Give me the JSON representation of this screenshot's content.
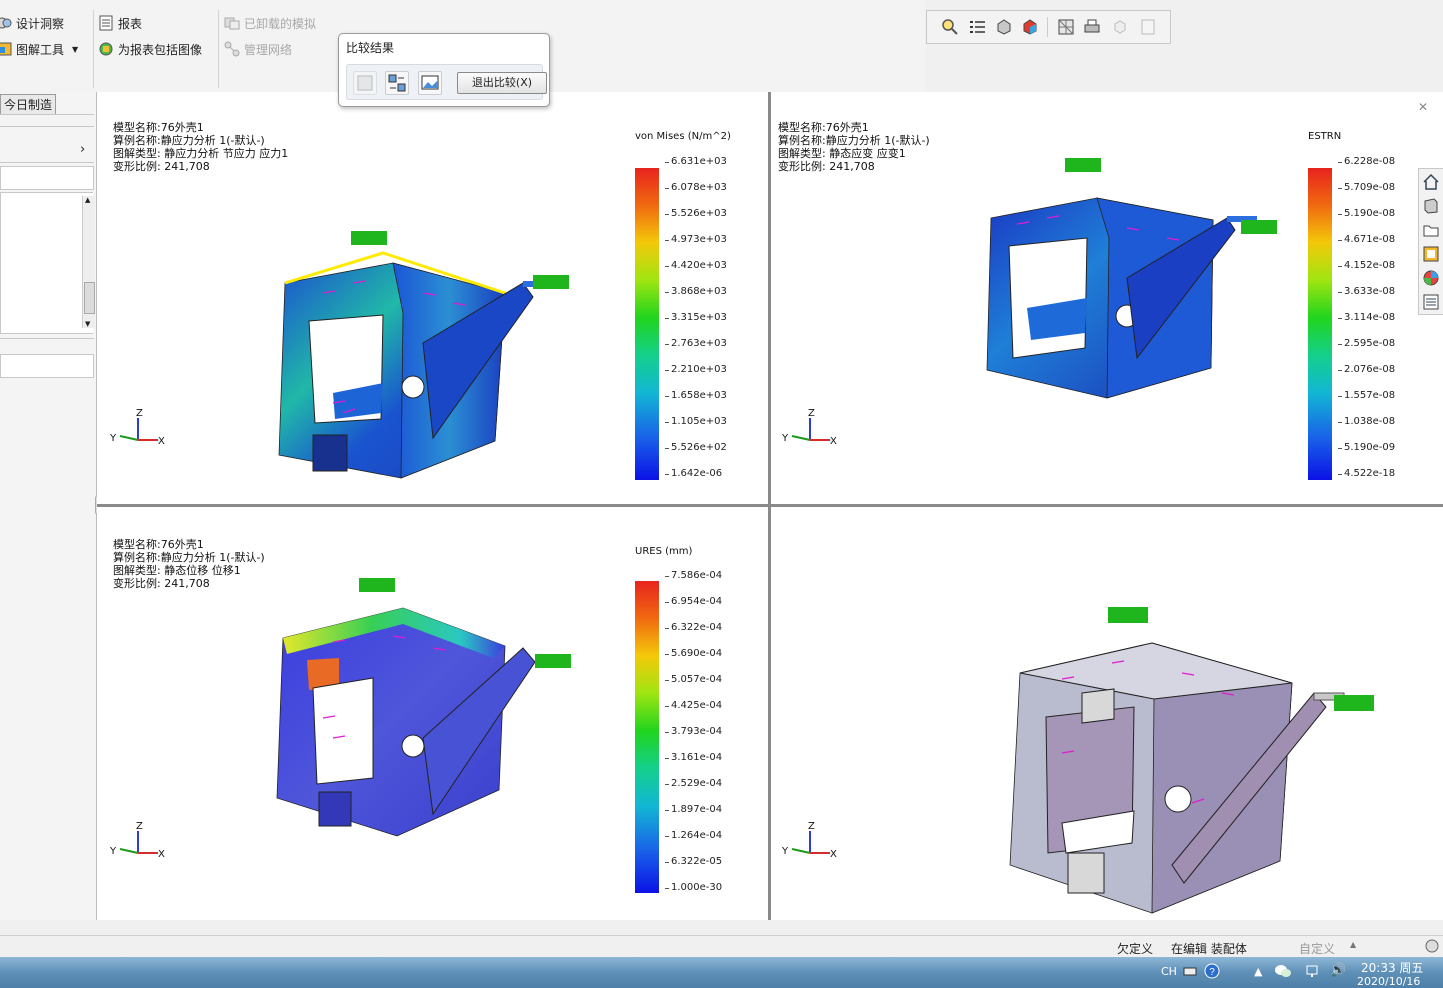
{
  "ribbon": {
    "design_insight": "设计洞察",
    "plot_tools": "图解工具",
    "report": "报表",
    "include_image": "为报表包括图像",
    "unloaded_sims": "已卸载的模拟",
    "manage_network": "管理网络"
  },
  "compare": {
    "title": "比较结果",
    "exit_label": "退出比较(X)"
  },
  "left_panel": {
    "tab_label": "今日制造"
  },
  "viewports": [
    {
      "model": "模型名称:76外壳1",
      "study": "算例名称:静应力分析 1(-默认-)",
      "plot": "图解类型: 静应力分析 节应力 应力1",
      "scale": "变形比例: 241,708",
      "legend_title": "von Mises (N/m^2)",
      "ticks": [
        "6.631e+03",
        "6.078e+03",
        "5.526e+03",
        "4.973e+03",
        "4.420e+03",
        "3.868e+03",
        "3.315e+03",
        "2.763e+03",
        "2.210e+03",
        "1.658e+03",
        "1.105e+03",
        "5.526e+02",
        "1.642e-06"
      ]
    },
    {
      "model": "模型名称:76外壳1",
      "study": "算例名称:静应力分析 1(-默认-)",
      "plot": "图解类型: 静态应变 应变1",
      "scale": "变形比例: 241,708",
      "legend_title": "ESTRN",
      "ticks": [
        "6.228e-08",
        "5.709e-08",
        "5.190e-08",
        "4.671e-08",
        "4.152e-08",
        "3.633e-08",
        "3.114e-08",
        "2.595e-08",
        "2.076e-08",
        "1.557e-08",
        "1.038e-08",
        "5.190e-09",
        "4.522e-18"
      ]
    },
    {
      "model": "模型名称:76外壳1",
      "study": "算例名称:静应力分析 1(-默认-)",
      "plot": "图解类型: 静态位移 位移1",
      "scale": "变形比例: 241,708",
      "legend_title": "URES (mm)",
      "ticks": [
        "7.586e-04",
        "6.954e-04",
        "6.322e-04",
        "5.690e-04",
        "5.057e-04",
        "4.425e-04",
        "3.793e-04",
        "3.161e-04",
        "2.529e-04",
        "1.897e-04",
        "1.264e-04",
        "6.322e-05",
        "1.000e-30"
      ]
    }
  ],
  "axes": {
    "x": "X",
    "y": "Y",
    "z": "Z"
  },
  "status": {
    "under_defined": "欠定义",
    "editing": "在编辑 装配体",
    "custom": "自定义"
  },
  "taskbar": {
    "lang": "CH",
    "time": "20:33 周五",
    "date": "2020/10/16"
  },
  "colors": {
    "accent": "#0b12e6",
    "tabbg": "#e9e9e9",
    "taskbar": "#5d8fb7"
  }
}
